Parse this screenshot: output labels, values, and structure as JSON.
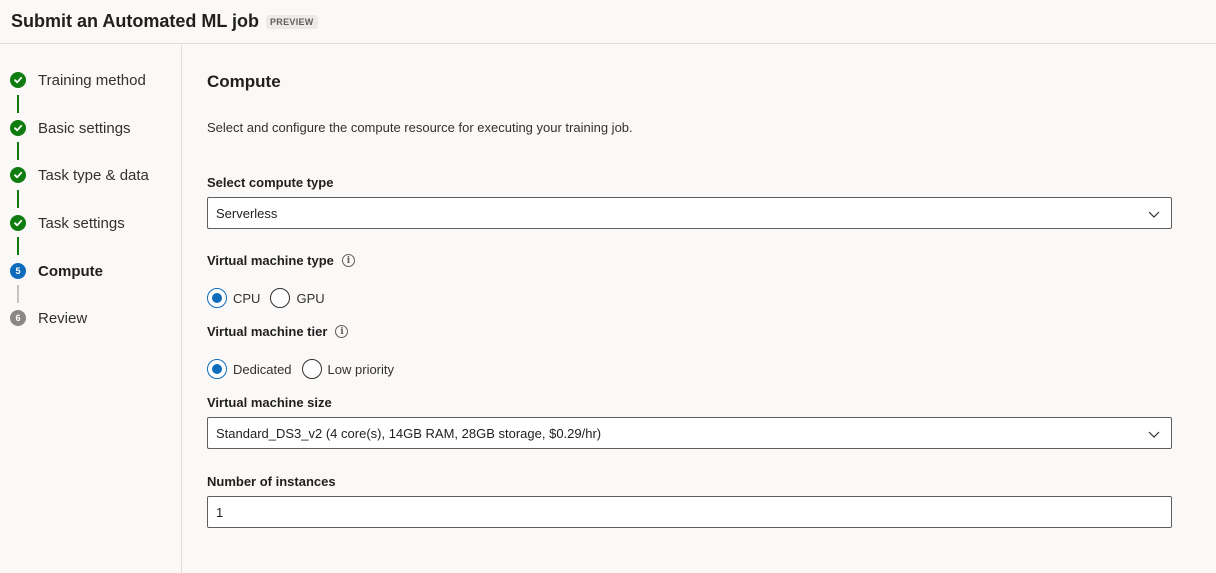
{
  "header": {
    "title": "Submit an Automated ML job",
    "badge": "PREVIEW"
  },
  "steps": [
    {
      "label": "Training method",
      "state": "done",
      "icon": "check-icon"
    },
    {
      "label": "Basic settings",
      "state": "done",
      "icon": "check-icon"
    },
    {
      "label": "Task type & data",
      "state": "done",
      "icon": "check-icon"
    },
    {
      "label": "Task settings",
      "state": "done",
      "icon": "check-icon"
    },
    {
      "label": "Compute",
      "state": "active",
      "number": "5"
    },
    {
      "label": "Review",
      "state": "pending",
      "number": "6"
    }
  ],
  "main": {
    "title": "Compute",
    "description": "Select and configure the compute resource for executing your training job.",
    "compute_type": {
      "label": "Select compute type",
      "value": "Serverless"
    },
    "vm_type": {
      "label": "Virtual machine type",
      "options": [
        "CPU",
        "GPU"
      ],
      "selected": "CPU"
    },
    "vm_tier": {
      "label": "Virtual machine tier",
      "options": [
        "Dedicated",
        "Low priority"
      ],
      "selected": "Dedicated"
    },
    "vm_size": {
      "label": "Virtual machine size",
      "value": "Standard_DS3_v2 (4 core(s), 14GB RAM, 28GB storage, $0.29/hr)"
    },
    "instances": {
      "label": "Number of instances",
      "value": "1"
    }
  },
  "colors": {
    "done": "#107c10",
    "active": "#0f6cbd",
    "pending": "#8a8886"
  }
}
